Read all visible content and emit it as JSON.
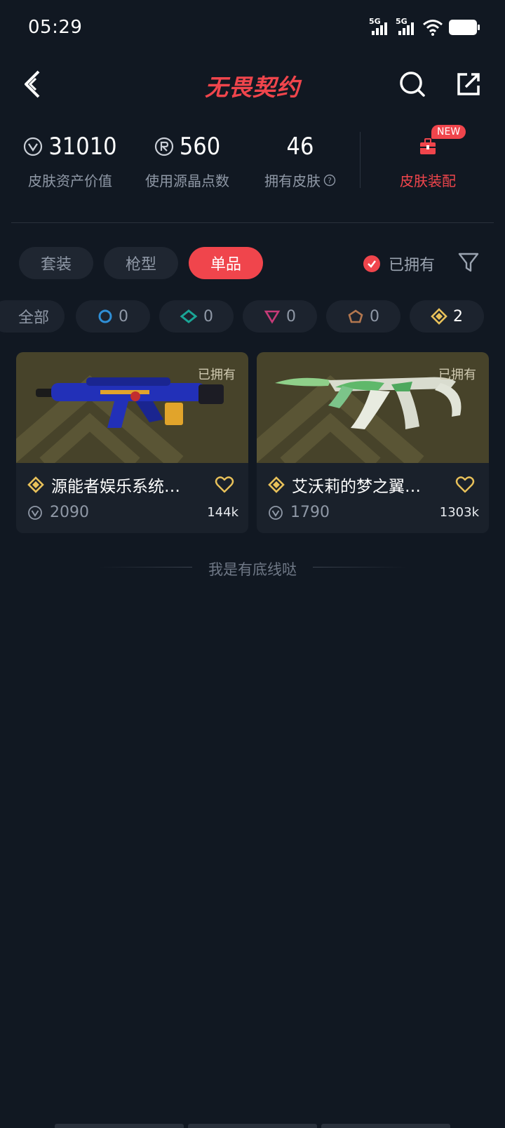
{
  "status_bar": {
    "time": "05:29",
    "signal1": "5G",
    "signal2": "5G"
  },
  "app": {
    "title": "无畏契约"
  },
  "stats": {
    "asset_value": {
      "value": "31010",
      "label": "皮肤资产价值"
    },
    "radianite": {
      "value": "560",
      "label": "使用源晶点数"
    },
    "skins_owned": {
      "value": "46",
      "label": "拥有皮肤"
    },
    "equip": {
      "label": "皮肤装配",
      "badge": "NEW"
    }
  },
  "filters": {
    "tabs": [
      "套装",
      "枪型",
      "单品"
    ],
    "active_tab": "单品",
    "owned_toggle_label": "已拥有"
  },
  "tiers": [
    {
      "label": "全部",
      "count": "",
      "icon": "all"
    },
    {
      "label": "",
      "count": "0",
      "icon": "select-tier-icon",
      "color": "#2f8fd6"
    },
    {
      "label": "",
      "count": "0",
      "icon": "deluxe-tier-icon",
      "color": "#1aa596"
    },
    {
      "label": "",
      "count": "0",
      "icon": "premium-tier-icon",
      "color": "#c63b78"
    },
    {
      "label": "",
      "count": "0",
      "icon": "ultra-tier-icon",
      "color": "#b3774f"
    },
    {
      "label": "",
      "count": "2",
      "icon": "exclusive-tier-icon",
      "color": "#e8c15a"
    }
  ],
  "cards": [
    {
      "owned": "已拥有",
      "name": "源能者娱乐系统…",
      "price": "2090",
      "likes": "144k"
    },
    {
      "owned": "已拥有",
      "name": "艾沃莉的梦之翼…",
      "price": "1790",
      "likes": "1303k"
    }
  ],
  "footer": {
    "text": "我是有底线哒"
  },
  "colors": {
    "accent": "#f0454c",
    "background": "#111822",
    "exclusive": "#e8c15a"
  }
}
